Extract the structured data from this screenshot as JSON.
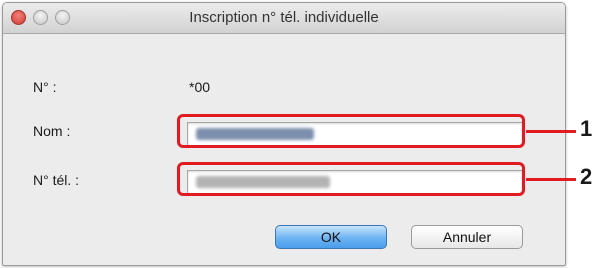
{
  "window": {
    "title": "Inscription n° tél. individuelle"
  },
  "form": {
    "number_label": "N° :",
    "number_value": "*00",
    "name_label": "Nom :",
    "phone_label": "N° tél. :"
  },
  "callouts": {
    "name_number": "1",
    "phone_number": "2",
    "color": "#e01c22"
  },
  "buttons": {
    "ok_label": "OK",
    "cancel_label": "Annuler"
  }
}
